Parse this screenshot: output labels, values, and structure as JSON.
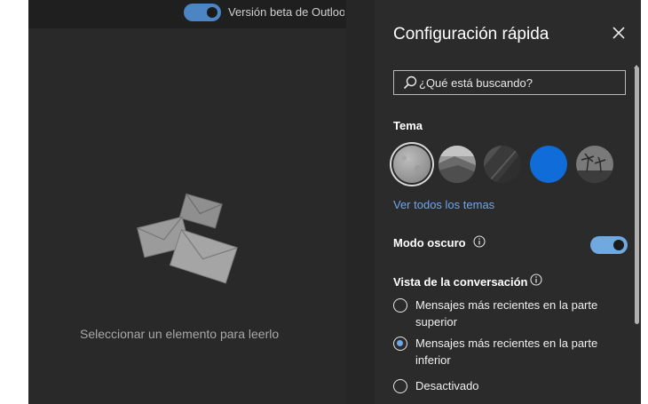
{
  "topbar": {
    "beta_label": "Versión beta de Outlook",
    "beta_toggle_on": true
  },
  "reading_pane": {
    "empty_message": "Seleccionar un elemento para leerlo",
    "illustration_icon": "envelopes-icon"
  },
  "quick_settings": {
    "title": "Configuración rápida",
    "close_icon": "close-icon",
    "search": {
      "placeholder": "¿Qué está buscando?",
      "value": ""
    },
    "theme": {
      "heading": "Tema",
      "options": [
        {
          "name": "gris",
          "selected": true
        },
        {
          "name": "paisaje"
        },
        {
          "name": "oscuro"
        },
        {
          "name": "azul",
          "color": "#0f6cd8"
        },
        {
          "name": "palmeras"
        }
      ],
      "see_all_link": "Ver todos los temas"
    },
    "dark_mode": {
      "label": "Modo oscuro",
      "on": true
    },
    "conversation_view": {
      "heading": "Vista de la conversación",
      "options": [
        {
          "label": "Mensajes más recientes en la parte superior",
          "checked": false
        },
        {
          "label": "Mensajes más recientes en la parte inferior",
          "checked": true
        },
        {
          "label": "Desactivado",
          "checked": false
        }
      ]
    }
  },
  "colors": {
    "accent": "#6ea7e6",
    "toggle": "#4b85c4",
    "panel_bg": "#2b2b2b",
    "app_bg": "#262626"
  }
}
